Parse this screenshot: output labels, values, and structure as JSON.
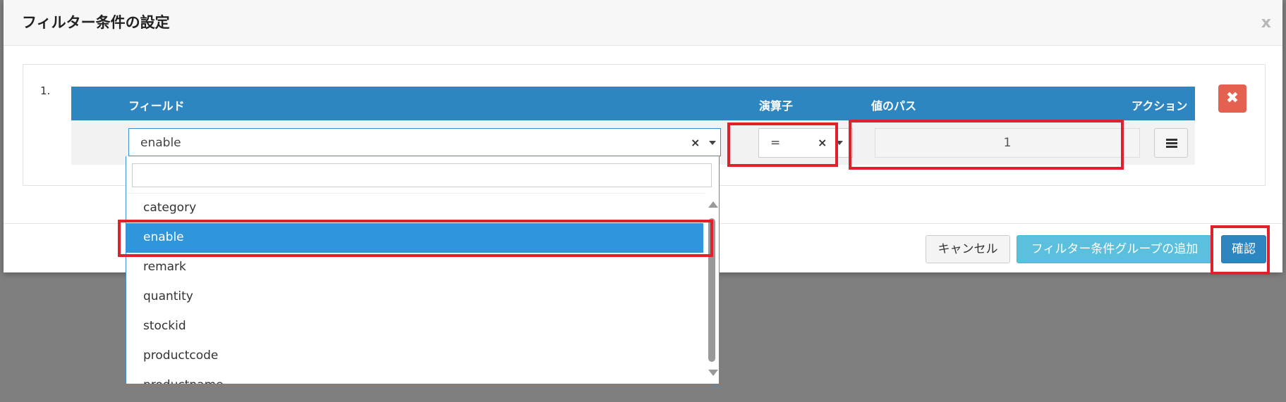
{
  "dialog": {
    "title": "フィルター条件の設定",
    "close_label": "x"
  },
  "condition": {
    "row_number": "1.",
    "headers": {
      "field": "フィールド",
      "operator": "演算子",
      "value_path": "値のパス",
      "action": "アクション"
    },
    "field_value": "enable",
    "operator_value": "=",
    "value_path_value": "1",
    "delete_label": "✖"
  },
  "dropdown": {
    "search_placeholder": "",
    "items": [
      "category",
      "enable",
      "remark",
      "quantity",
      "stockid",
      "productcode",
      "productname"
    ],
    "selected": "enable"
  },
  "footer": {
    "cancel_label": "キャンセル",
    "add_group_label": "フィルター条件グループの追加",
    "confirm_label": "確認"
  },
  "colors": {
    "header_blue": "#2e86c1",
    "selected_blue": "#2f96dc",
    "highlight_red": "#e0202a",
    "danger": "#e4604f",
    "info": "#5bc0de"
  }
}
